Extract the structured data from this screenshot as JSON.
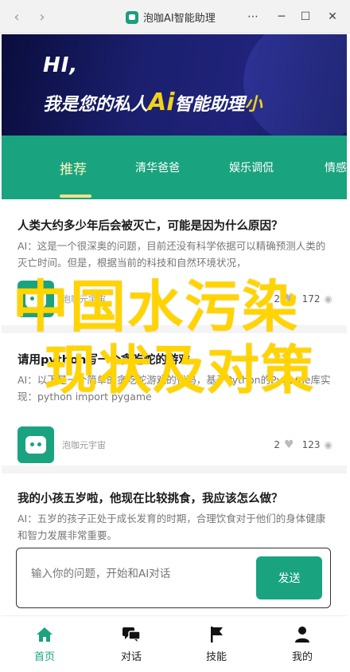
{
  "window": {
    "title": "泡咖AI智能助理",
    "controls": [
      "⋯",
      "─",
      "☐",
      "✕"
    ]
  },
  "banner": {
    "greeting": "HI,",
    "text_prefix": "我是您的私人",
    "text_ai": "Ai",
    "text_suffix": "智能助理",
    "text_cut": "小"
  },
  "tabs": [
    {
      "label": "推荐",
      "active": true
    },
    {
      "label": "清华爸爸",
      "active": false
    },
    {
      "label": "娱乐调侃",
      "active": false
    },
    {
      "label": "情感",
      "active": false
    }
  ],
  "feed": {
    "cards": [
      {
        "title": "人类大约多少年后会被灭亡，可能是因为什么原因？",
        "body": "AI：这是一个很深奥的问题，目前还没有科学依据可以精确预测人类的灭亡时间。但是，根据当前的科技和自然环境状况，",
        "author": "泡咖元宇宙",
        "likes": "2",
        "views": "172"
      },
      {
        "title": "请用python写一个贪吃蛇的游戏",
        "body": "AI：以下是一个简单的贪吃蛇游戏的代码，基于Python的Pygame库实现：python import pygame",
        "author": "泡咖元宇宙",
        "likes": "2",
        "views": "123"
      },
      {
        "title": "我的小孩五岁啦，他现在比较挑食，我应该怎么做？",
        "body": "AI：五岁的孩子正处于成长发育的时期，合理饮食对于他们的身体健康和智力发展非常重要。",
        "author": "",
        "likes": "",
        "views": ""
      }
    ]
  },
  "overlay": {
    "line1": "中国水污染",
    "line2": "现状及对策"
  },
  "input": {
    "placeholder": "输入你的问题，开始和AI对话",
    "send_label": "发送"
  },
  "bottom_nav": [
    {
      "label": "首页",
      "icon": "home-icon",
      "active": true
    },
    {
      "label": "对话",
      "icon": "chat-icon",
      "active": false
    },
    {
      "label": "技能",
      "icon": "flag-icon",
      "active": false
    },
    {
      "label": "我的",
      "icon": "user-icon",
      "active": false
    }
  ],
  "colors": {
    "accent": "#1aa37f",
    "overlay": "#ffd400",
    "banner_bg": "#141864"
  }
}
